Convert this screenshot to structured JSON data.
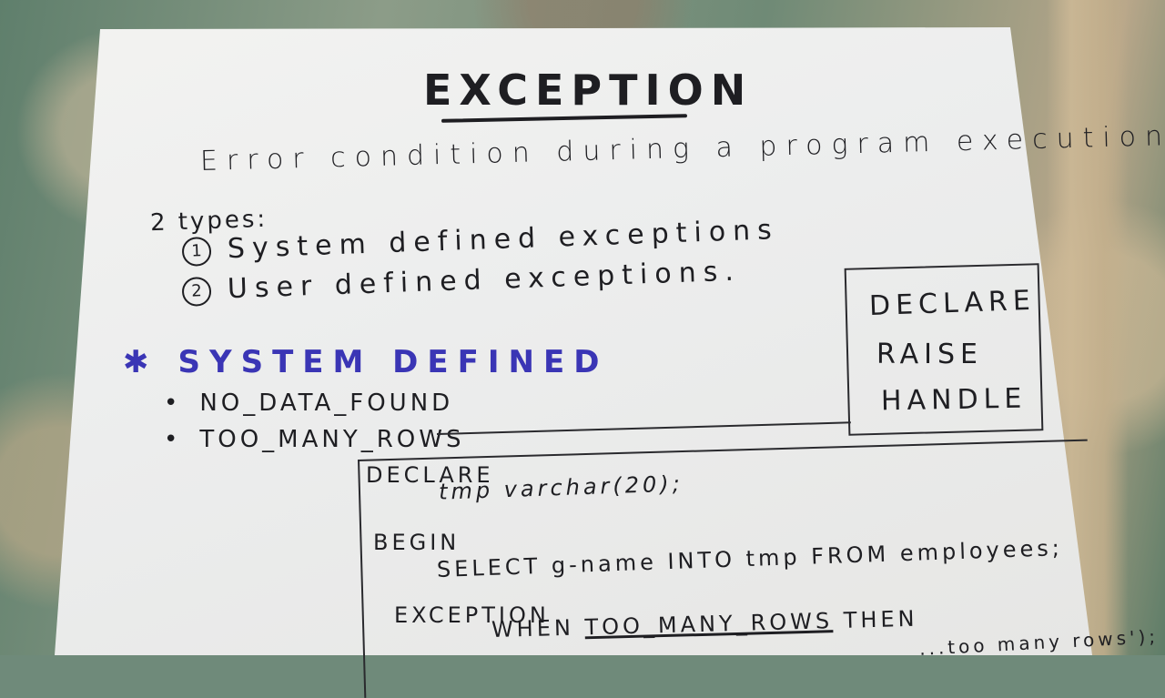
{
  "note": {
    "title": "EXCEPTION",
    "definition": "Error condition during a program execution.",
    "types_label": "2 types:",
    "types": [
      {
        "number": "1",
        "label": "System defined exceptions"
      },
      {
        "number": "2",
        "label": "User defined exceptions."
      }
    ],
    "system_defined": {
      "marker": "✱",
      "heading": "SYSTEM DEFINED",
      "items": [
        "NO_DATA_FOUND",
        "TOO_MANY_ROWS"
      ]
    },
    "side_box": [
      "DECLARE",
      "RAISE",
      "HANDLE"
    ],
    "code": {
      "line1": "DECLARE",
      "line2": "tmp varchar(20);",
      "line3": "BEGIN",
      "line4": "SELECT g-name INTO tmp FROM employees;",
      "line5": "EXCEPTION",
      "line6_prefix": "WHEN ",
      "line6_keyword": "TOO_MANY_ROWS",
      "line6_suffix": " THEN",
      "line7": "...too many rows');"
    },
    "colors": {
      "ink": "#1e1e22",
      "heading_ink": "#3a35b5",
      "paper": "#ececeb",
      "background": "#6f8a7a"
    }
  }
}
